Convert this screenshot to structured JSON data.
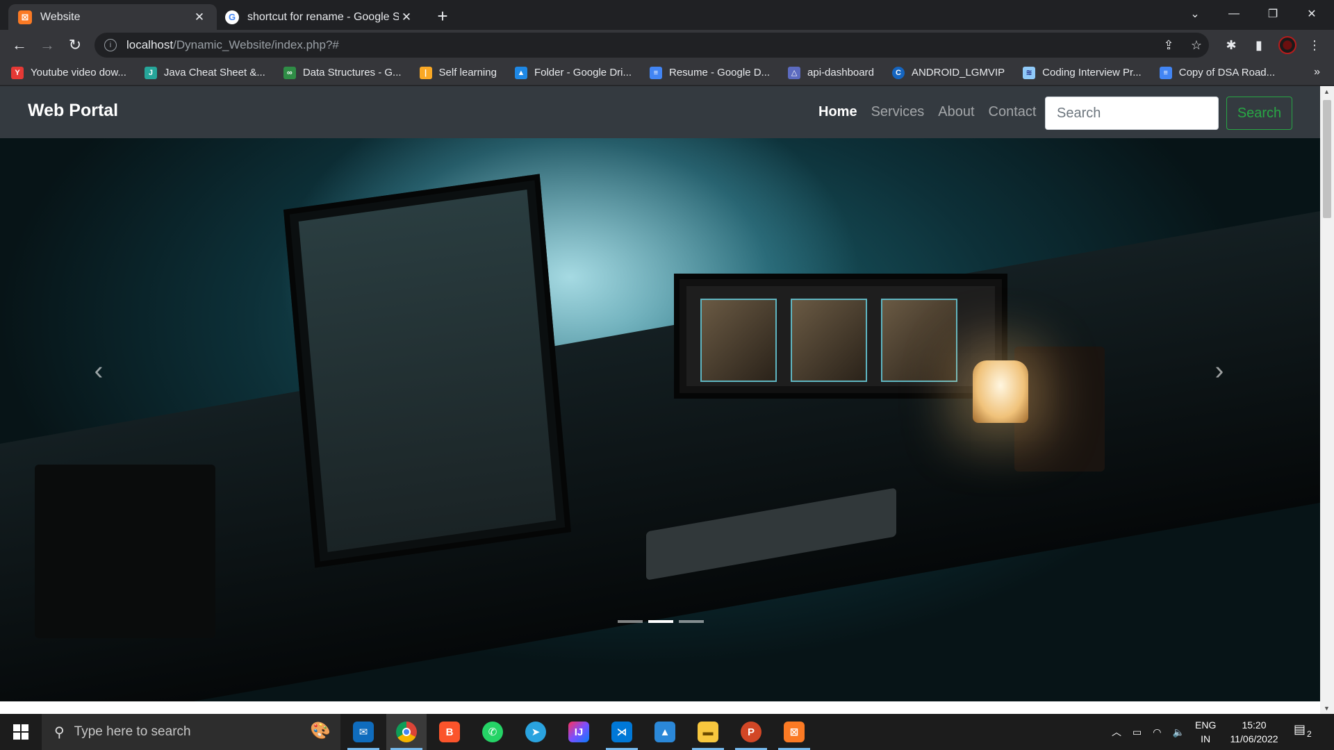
{
  "browser": {
    "tabs": [
      {
        "title": "Website",
        "icon": "xampp-icon",
        "active": true
      },
      {
        "title": "shortcut for rename - Google Se",
        "icon": "google-icon",
        "active": false
      }
    ],
    "url_host": "localhost",
    "url_path": "/Dynamic_Website/index.php?#",
    "bookmarks": [
      {
        "label": "Youtube video dow...",
        "icon": "bird-icon",
        "color": "#e53935"
      },
      {
        "label": "Java Cheat Sheet &...",
        "icon": "swirl-icon",
        "color": "#26a69a"
      },
      {
        "label": "Data Structures - G...",
        "icon": "gfg-icon",
        "color": "#2f8d46"
      },
      {
        "label": "Self learning",
        "icon": "bars-icon",
        "color": "#f9a825"
      },
      {
        "label": "Folder - Google Dri...",
        "icon": "drive-icon",
        "color": "#1e88e5"
      },
      {
        "label": "Resume - Google D...",
        "icon": "docs-icon",
        "color": "#4285f4"
      },
      {
        "label": "api-dashboard",
        "icon": "triangle-icon",
        "color": "#5c6bc0"
      },
      {
        "label": "ANDROID_LGMVIP",
        "icon": "c-icon",
        "color": "#1565c0"
      },
      {
        "label": "Coding Interview Pr...",
        "icon": "layers-icon",
        "color": "#90caf9"
      },
      {
        "label": "Copy of DSA Road...",
        "icon": "docs-icon",
        "color": "#4285f4"
      }
    ],
    "bookmarks_more": "»"
  },
  "site": {
    "brand": "Web Portal",
    "nav": [
      "Home",
      "Services",
      "About",
      "Contact"
    ],
    "active_nav": "Home",
    "search_placeholder": "Search",
    "search_button": "Search",
    "carousel_prev": "‹",
    "carousel_next": "›",
    "slide_count": 3,
    "active_slide": 2
  },
  "taskbar": {
    "search_placeholder": "Type here to search",
    "apps": [
      "mail",
      "chrome",
      "brave",
      "whatsapp",
      "telegram",
      "intellij",
      "vscode",
      "photos",
      "file-explorer",
      "powerpoint",
      "xampp"
    ],
    "lang_top": "ENG",
    "lang_bottom": "IN",
    "time": "15:20",
    "date": "11/06/2022",
    "notifications": "2"
  },
  "colors": {
    "navbar_bg": "#343a40",
    "search_green": "#28a745",
    "chrome_dark": "#202124",
    "chrome_toolbar": "#35363a"
  }
}
